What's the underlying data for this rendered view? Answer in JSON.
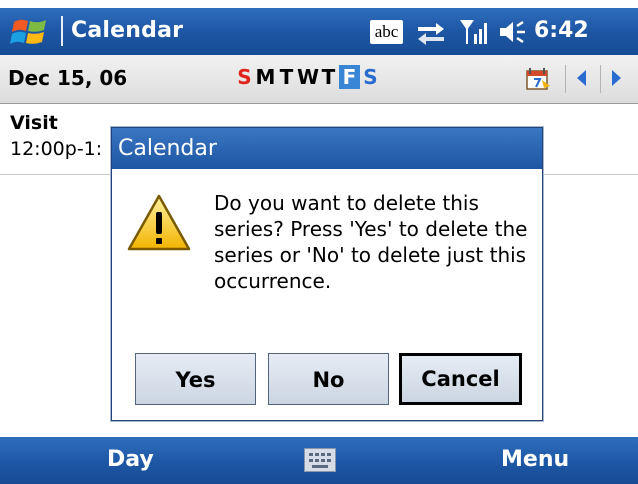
{
  "title_bar": {
    "title": "Calendar",
    "input_mode": "abc",
    "time": "6:42",
    "icons": [
      "windows-start-icon",
      "connectivity-icon",
      "signal-icon",
      "volume-icon"
    ]
  },
  "date_bar": {
    "date": "Dec 15, 06",
    "week_days": [
      "S",
      "M",
      "T",
      "W",
      "T",
      "F",
      "S"
    ],
    "selected_day_index": 5
  },
  "appointment": {
    "title": "Visit",
    "time": "12:00p-1:"
  },
  "dialog": {
    "title": "Calendar",
    "message": "Do you want to delete this series? Press 'Yes' to delete the series or 'No' to delete just this occurrence.",
    "buttons": {
      "yes": "Yes",
      "no": "No",
      "cancel": "Cancel"
    }
  },
  "menu_bar": {
    "left_softkey": "Day",
    "right_softkey": "Menu"
  },
  "colors": {
    "title_blue": "#1f58a6",
    "weekend_red": "#e0241b",
    "weekday_blue": "#2a6bd0",
    "today_highlight": "#3a86d6"
  }
}
